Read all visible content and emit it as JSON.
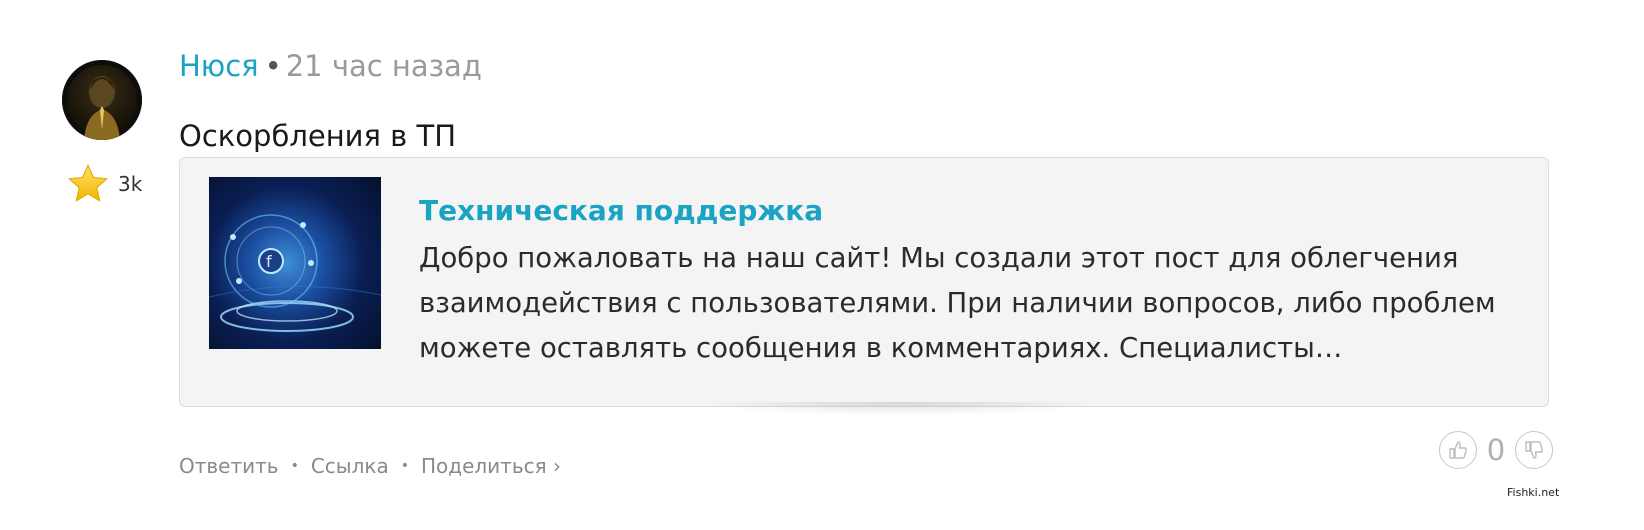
{
  "comment": {
    "author": "Нюся",
    "separator": "•",
    "time": "21 час назад",
    "rating": "3k",
    "text": "Оскорбления в ТП"
  },
  "card": {
    "title": "Техническая поддержка",
    "description": "Добро пожаловать на наш сайт! Мы создали этот пост для облегчения взаимодействия с пользователями. При наличии вопросов, либо проблем можете оставлять сообщения в комментариях. Специалисты…"
  },
  "actions": {
    "reply": "Ответить",
    "link": "Ссылка",
    "share": "Поделиться ›",
    "separator": "•"
  },
  "vote": {
    "score": "0"
  },
  "watermark": "Fishki.net",
  "colors": {
    "accent": "#1aa3c2",
    "muted": "#9a9a9a"
  }
}
